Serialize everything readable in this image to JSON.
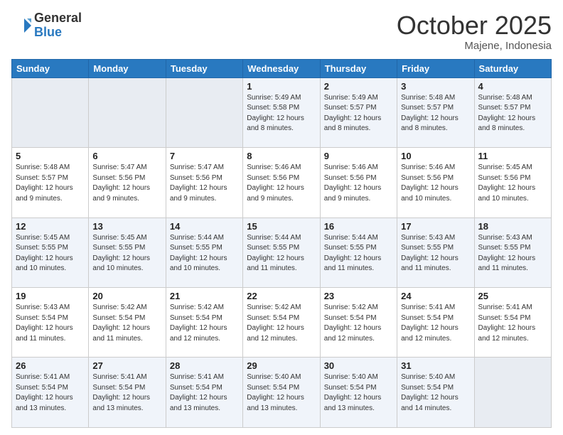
{
  "header": {
    "logo_general": "General",
    "logo_blue": "Blue",
    "month": "October 2025",
    "location": "Majene, Indonesia"
  },
  "weekdays": [
    "Sunday",
    "Monday",
    "Tuesday",
    "Wednesday",
    "Thursday",
    "Friday",
    "Saturday"
  ],
  "weeks": [
    [
      {
        "day": "",
        "info": ""
      },
      {
        "day": "",
        "info": ""
      },
      {
        "day": "",
        "info": ""
      },
      {
        "day": "1",
        "info": "Sunrise: 5:49 AM\nSunset: 5:58 PM\nDaylight: 12 hours\nand 8 minutes."
      },
      {
        "day": "2",
        "info": "Sunrise: 5:49 AM\nSunset: 5:57 PM\nDaylight: 12 hours\nand 8 minutes."
      },
      {
        "day": "3",
        "info": "Sunrise: 5:48 AM\nSunset: 5:57 PM\nDaylight: 12 hours\nand 8 minutes."
      },
      {
        "day": "4",
        "info": "Sunrise: 5:48 AM\nSunset: 5:57 PM\nDaylight: 12 hours\nand 8 minutes."
      }
    ],
    [
      {
        "day": "5",
        "info": "Sunrise: 5:48 AM\nSunset: 5:57 PM\nDaylight: 12 hours\nand 9 minutes."
      },
      {
        "day": "6",
        "info": "Sunrise: 5:47 AM\nSunset: 5:56 PM\nDaylight: 12 hours\nand 9 minutes."
      },
      {
        "day": "7",
        "info": "Sunrise: 5:47 AM\nSunset: 5:56 PM\nDaylight: 12 hours\nand 9 minutes."
      },
      {
        "day": "8",
        "info": "Sunrise: 5:46 AM\nSunset: 5:56 PM\nDaylight: 12 hours\nand 9 minutes."
      },
      {
        "day": "9",
        "info": "Sunrise: 5:46 AM\nSunset: 5:56 PM\nDaylight: 12 hours\nand 9 minutes."
      },
      {
        "day": "10",
        "info": "Sunrise: 5:46 AM\nSunset: 5:56 PM\nDaylight: 12 hours\nand 10 minutes."
      },
      {
        "day": "11",
        "info": "Sunrise: 5:45 AM\nSunset: 5:56 PM\nDaylight: 12 hours\nand 10 minutes."
      }
    ],
    [
      {
        "day": "12",
        "info": "Sunrise: 5:45 AM\nSunset: 5:55 PM\nDaylight: 12 hours\nand 10 minutes."
      },
      {
        "day": "13",
        "info": "Sunrise: 5:45 AM\nSunset: 5:55 PM\nDaylight: 12 hours\nand 10 minutes."
      },
      {
        "day": "14",
        "info": "Sunrise: 5:44 AM\nSunset: 5:55 PM\nDaylight: 12 hours\nand 10 minutes."
      },
      {
        "day": "15",
        "info": "Sunrise: 5:44 AM\nSunset: 5:55 PM\nDaylight: 12 hours\nand 11 minutes."
      },
      {
        "day": "16",
        "info": "Sunrise: 5:44 AM\nSunset: 5:55 PM\nDaylight: 12 hours\nand 11 minutes."
      },
      {
        "day": "17",
        "info": "Sunrise: 5:43 AM\nSunset: 5:55 PM\nDaylight: 12 hours\nand 11 minutes."
      },
      {
        "day": "18",
        "info": "Sunrise: 5:43 AM\nSunset: 5:55 PM\nDaylight: 12 hours\nand 11 minutes."
      }
    ],
    [
      {
        "day": "19",
        "info": "Sunrise: 5:43 AM\nSunset: 5:54 PM\nDaylight: 12 hours\nand 11 minutes."
      },
      {
        "day": "20",
        "info": "Sunrise: 5:42 AM\nSunset: 5:54 PM\nDaylight: 12 hours\nand 11 minutes."
      },
      {
        "day": "21",
        "info": "Sunrise: 5:42 AM\nSunset: 5:54 PM\nDaylight: 12 hours\nand 12 minutes."
      },
      {
        "day": "22",
        "info": "Sunrise: 5:42 AM\nSunset: 5:54 PM\nDaylight: 12 hours\nand 12 minutes."
      },
      {
        "day": "23",
        "info": "Sunrise: 5:42 AM\nSunset: 5:54 PM\nDaylight: 12 hours\nand 12 minutes."
      },
      {
        "day": "24",
        "info": "Sunrise: 5:41 AM\nSunset: 5:54 PM\nDaylight: 12 hours\nand 12 minutes."
      },
      {
        "day": "25",
        "info": "Sunrise: 5:41 AM\nSunset: 5:54 PM\nDaylight: 12 hours\nand 12 minutes."
      }
    ],
    [
      {
        "day": "26",
        "info": "Sunrise: 5:41 AM\nSunset: 5:54 PM\nDaylight: 12 hours\nand 13 minutes."
      },
      {
        "day": "27",
        "info": "Sunrise: 5:41 AM\nSunset: 5:54 PM\nDaylight: 12 hours\nand 13 minutes."
      },
      {
        "day": "28",
        "info": "Sunrise: 5:41 AM\nSunset: 5:54 PM\nDaylight: 12 hours\nand 13 minutes."
      },
      {
        "day": "29",
        "info": "Sunrise: 5:40 AM\nSunset: 5:54 PM\nDaylight: 12 hours\nand 13 minutes."
      },
      {
        "day": "30",
        "info": "Sunrise: 5:40 AM\nSunset: 5:54 PM\nDaylight: 12 hours\nand 13 minutes."
      },
      {
        "day": "31",
        "info": "Sunrise: 5:40 AM\nSunset: 5:54 PM\nDaylight: 12 hours\nand 14 minutes."
      },
      {
        "day": "",
        "info": ""
      }
    ]
  ]
}
